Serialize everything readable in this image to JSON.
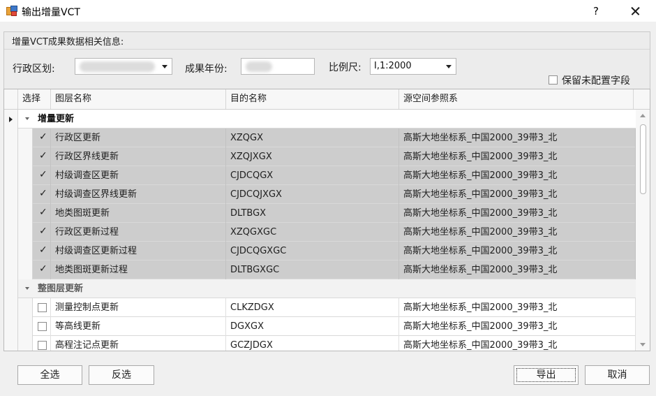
{
  "window": {
    "title": "输出增量VCT",
    "help_label": "?"
  },
  "group": {
    "title": "增量VCT成果数据相关信息:",
    "region_label": "行政区划:",
    "year_label": "成果年份:",
    "scale_label": "比例尺:",
    "scale_value": "I,1:2000",
    "keep_unconfigured_label": "保留未配置字段",
    "keep_unconfigured_checked": false
  },
  "grid": {
    "columns": [
      "选择",
      "图层名称",
      "目的名称",
      "源空间参照系"
    ],
    "groups": [
      {
        "label": "增量更新",
        "rows": [
          {
            "checked": true,
            "layer": "行政区更新",
            "target": "XZQGX",
            "srs": "高斯大地坐标系_中国2000_39带3_北"
          },
          {
            "checked": true,
            "layer": "行政区界线更新",
            "target": "XZQJXGX",
            "srs": "高斯大地坐标系_中国2000_39带3_北"
          },
          {
            "checked": true,
            "layer": "村级调查区更新",
            "target": "CJDCQGX",
            "srs": "高斯大地坐标系_中国2000_39带3_北"
          },
          {
            "checked": true,
            "layer": "村级调查区界线更新",
            "target": "CJDCQJXGX",
            "srs": "高斯大地坐标系_中国2000_39带3_北"
          },
          {
            "checked": true,
            "layer": "地类图斑更新",
            "target": "DLTBGX",
            "srs": "高斯大地坐标系_中国2000_39带3_北"
          },
          {
            "checked": true,
            "layer": "行政区更新过程",
            "target": "XZQGXGC",
            "srs": "高斯大地坐标系_中国2000_39带3_北"
          },
          {
            "checked": true,
            "layer": "村级调查区更新过程",
            "target": "CJDCQGXGC",
            "srs": "高斯大地坐标系_中国2000_39带3_北"
          },
          {
            "checked": true,
            "layer": "地类图斑更新过程",
            "target": "DLTBGXGC",
            "srs": "高斯大地坐标系_中国2000_39带3_北"
          }
        ]
      },
      {
        "label": "整图层更新",
        "rows": [
          {
            "checked": false,
            "layer": "测量控制点更新",
            "target": "CLKZDGX",
            "srs": "高斯大地坐标系_中国2000_39带3_北"
          },
          {
            "checked": false,
            "layer": "等高线更新",
            "target": "DGXGX",
            "srs": "高斯大地坐标系_中国2000_39带3_北"
          },
          {
            "checked": false,
            "layer": "高程注记点更新",
            "target": "GCZJDGX",
            "srs": "高斯大地坐标系_中国2000_39带3_北"
          }
        ]
      }
    ]
  },
  "buttons": {
    "select_all": "全选",
    "invert": "反选",
    "export": "导出",
    "cancel": "取消"
  },
  "icons": {
    "check": "✓"
  }
}
